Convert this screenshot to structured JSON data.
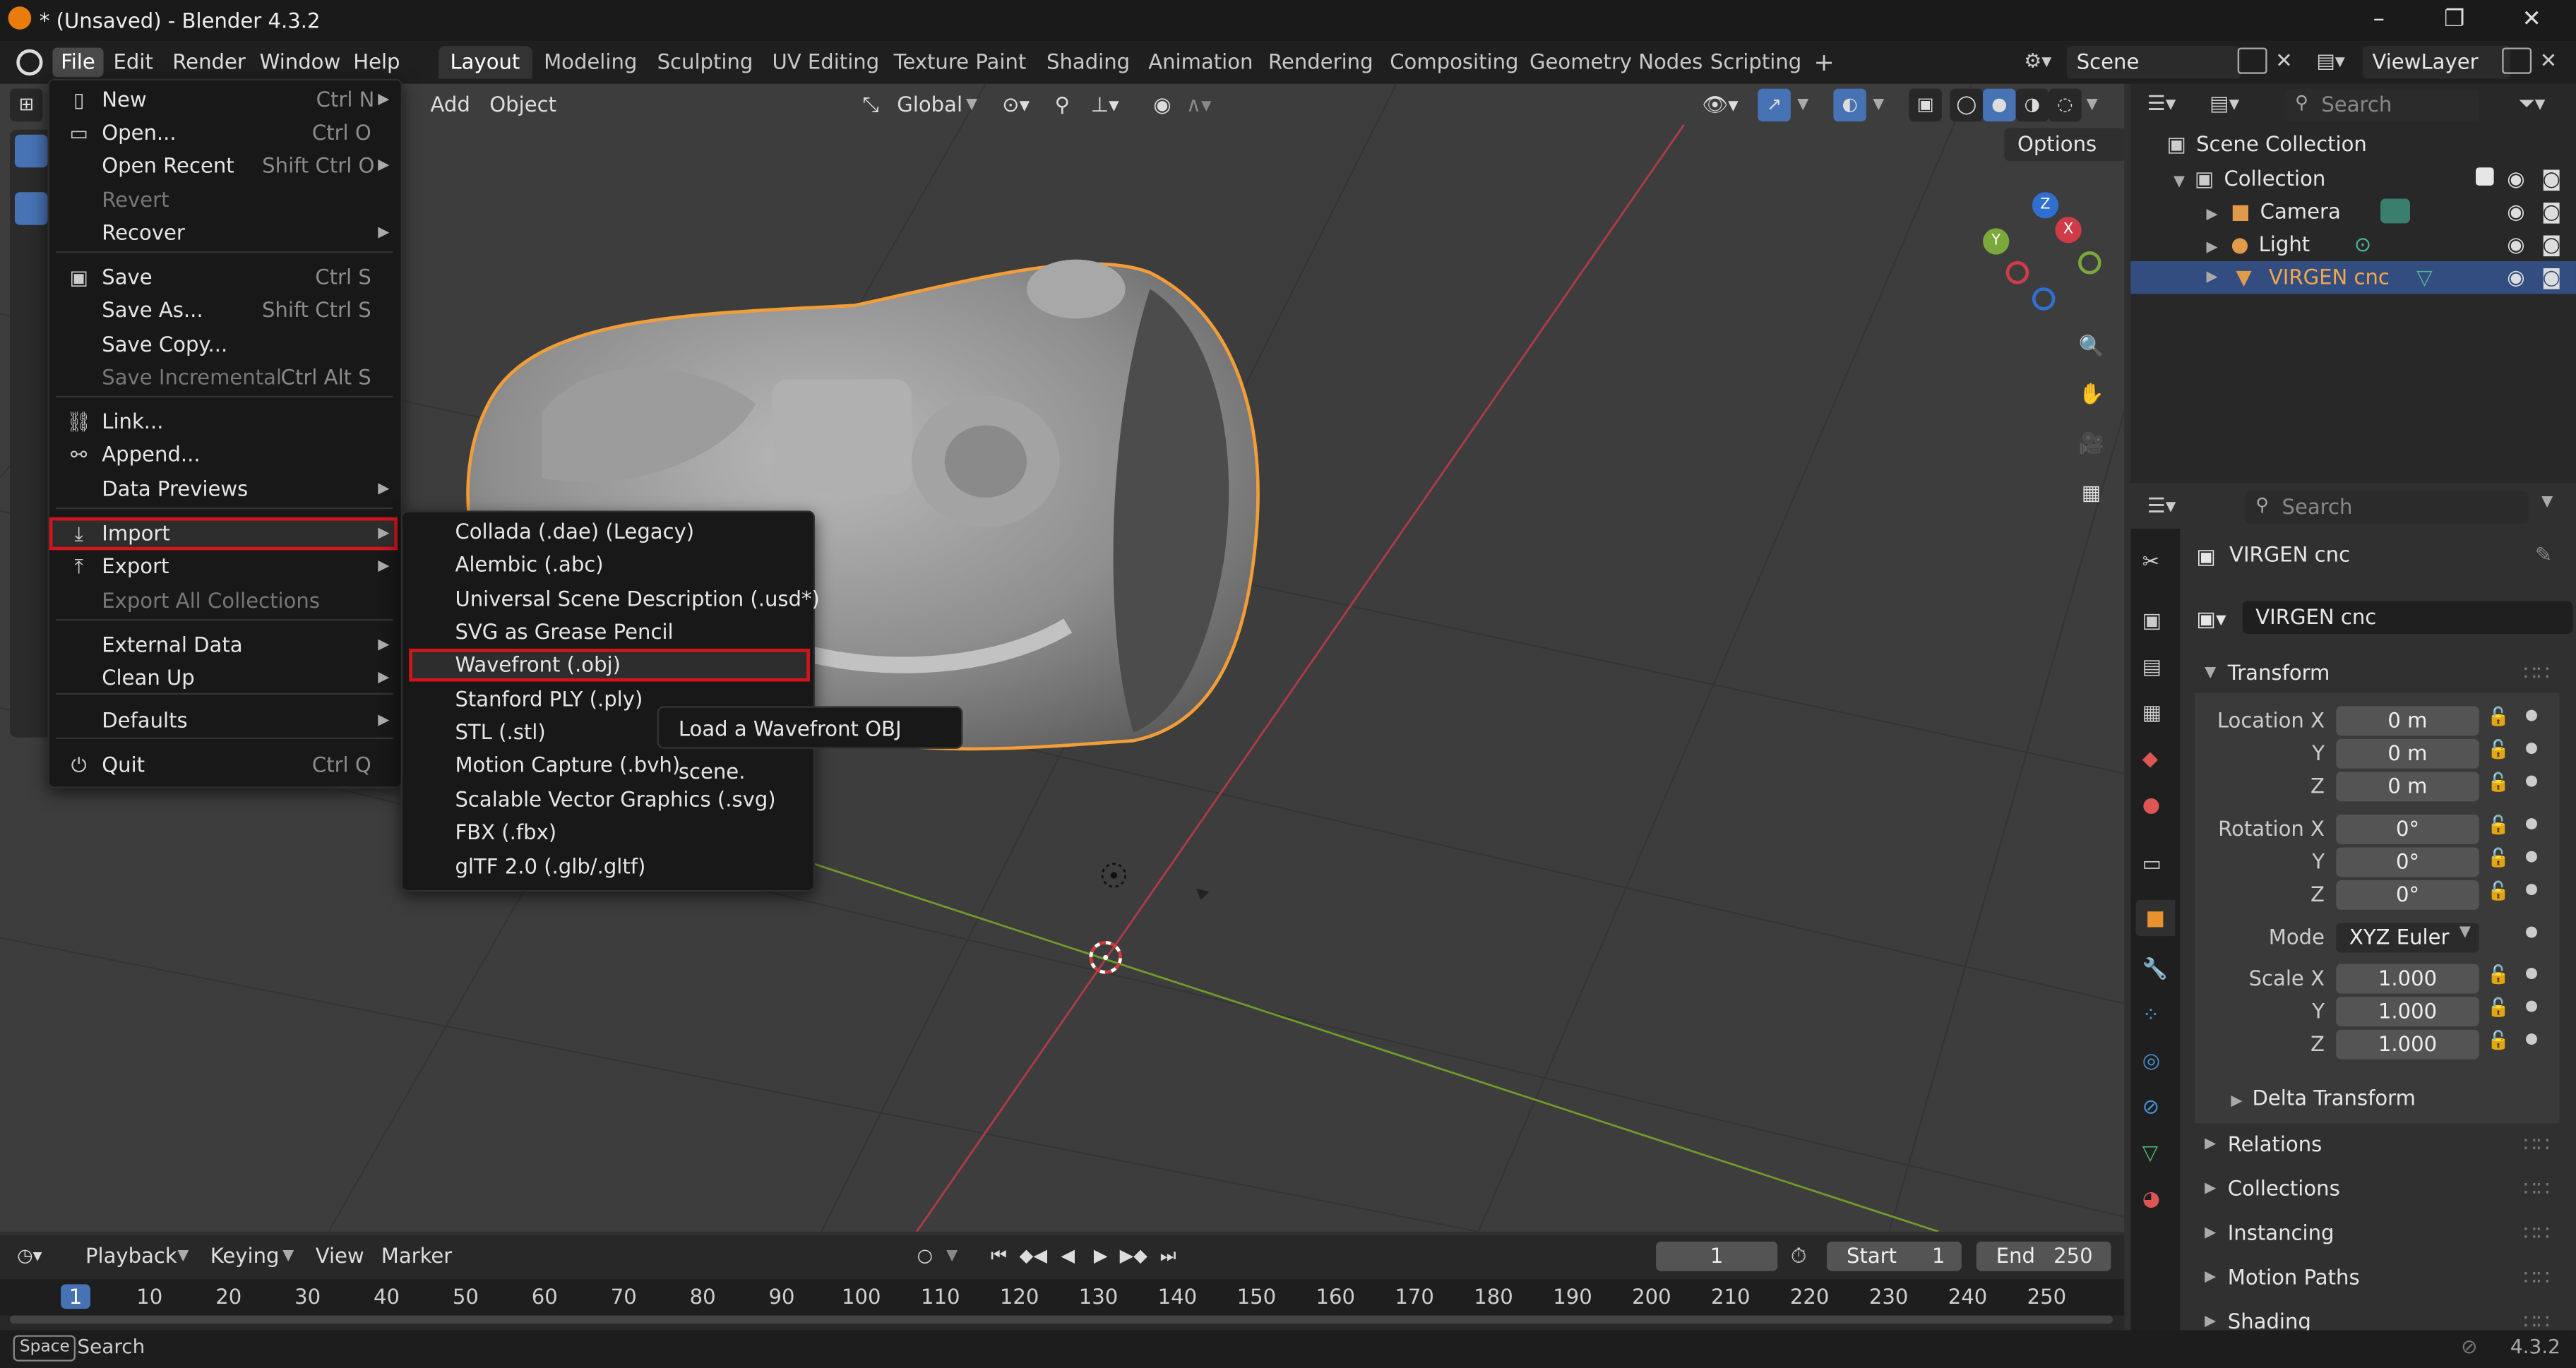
{
  "window": {
    "title": "* (Unsaved) - Blender 4.3.2",
    "minimize": "–",
    "maximize": "❐",
    "close": "✕"
  },
  "menubar": [
    "File",
    "Edit",
    "Render",
    "Window",
    "Help"
  ],
  "workspaces": [
    "Layout",
    "Modeling",
    "Sculpting",
    "UV Editing",
    "Texture Paint",
    "Shading",
    "Animation",
    "Rendering",
    "Compositing",
    "Geometry Nodes",
    "Scripting"
  ],
  "add_workspace": "+",
  "scene": {
    "name": "Scene",
    "view_layer": "ViewLayer"
  },
  "viewport": {
    "header_add": "Add",
    "header_object": "Object",
    "orientation": "Global",
    "options": "Options",
    "gizmo": {
      "z": "Z",
      "x": "X",
      "y": "Y"
    }
  },
  "file_menu": {
    "items": [
      {
        "label": "New",
        "shortcut": "Ctrl N",
        "icon": "new-file-icon",
        "submenu": true
      },
      {
        "label": "Open...",
        "shortcut": "Ctrl O",
        "icon": "folder-icon"
      },
      {
        "label": "Open Recent",
        "shortcut": "Shift Ctrl O",
        "submenu": true
      },
      {
        "label": "Revert",
        "disabled": true
      },
      {
        "label": "Recover",
        "submenu": true
      },
      {
        "label": "Save",
        "shortcut": "Ctrl S",
        "icon": "save-icon"
      },
      {
        "label": "Save As...",
        "shortcut": "Shift Ctrl S"
      },
      {
        "label": "Save Copy..."
      },
      {
        "label": "Save Incremental",
        "shortcut": "Ctrl Alt S",
        "disabled": true
      },
      {
        "label": "Link...",
        "icon": "link-icon"
      },
      {
        "label": "Append...",
        "icon": "append-icon"
      },
      {
        "label": "Data Previews",
        "submenu": true
      },
      {
        "label": "Import",
        "icon": "import-icon",
        "submenu": true,
        "highlighted": true
      },
      {
        "label": "Export",
        "icon": "export-icon",
        "submenu": true
      },
      {
        "label": "Export All Collections",
        "disabled": true
      },
      {
        "label": "External Data",
        "submenu": true
      },
      {
        "label": "Clean Up",
        "submenu": true
      },
      {
        "label": "Defaults",
        "submenu": true
      },
      {
        "label": "Quit",
        "shortcut": "Ctrl Q",
        "icon": "power-icon"
      }
    ]
  },
  "import_menu": {
    "items": [
      "Collada (.dae) (Legacy)",
      "Alembic (.abc)",
      "Universal Scene Description (.usd*)",
      "SVG as Grease Pencil",
      "Wavefront (.obj)",
      "Stanford PLY (.ply)",
      "STL (.stl)",
      "Motion Capture (.bvh)",
      "Scalable Vector Graphics (.svg)",
      "FBX (.fbx)",
      "glTF 2.0 (.glb/.gltf)"
    ],
    "highlighted_index": 4
  },
  "tooltip": "Load a Wavefront OBJ scene.",
  "outliner": {
    "search_placeholder": "Search",
    "scene_collection": "Scene Collection",
    "collection": "Collection",
    "items": [
      {
        "name": "Camera"
      },
      {
        "name": "Light"
      },
      {
        "name": "VIRGEN cnc",
        "selected": true
      }
    ]
  },
  "properties": {
    "search_placeholder": "Search",
    "object_name": "VIRGEN cnc",
    "data_name": "VIRGEN cnc",
    "transform": "Transform",
    "location": {
      "label": "Location X",
      "x": "0 m",
      "y": "0 m",
      "z": "0 m"
    },
    "rotation": {
      "label": "Rotation X",
      "x": "0°",
      "y": "0°",
      "z": "0°"
    },
    "mode_label": "Mode",
    "mode": "XYZ Euler",
    "scale": {
      "label": "Scale X",
      "x": "1.000",
      "y": "1.000",
      "z": "1.000"
    },
    "axis_y": "Y",
    "axis_z": "Z",
    "delta_transform": "Delta Transform",
    "sections": [
      "Relations",
      "Collections",
      "Instancing",
      "Motion Paths",
      "Shading"
    ]
  },
  "timeline": {
    "playback": "Playback",
    "keying": "Keying",
    "view": "View",
    "marker": "Marker",
    "current_frame": "1",
    "start_label": "Start",
    "start": "1",
    "end_label": "End",
    "end": "250",
    "ticks": [
      "1",
      "10",
      "20",
      "30",
      "40",
      "50",
      "60",
      "70",
      "80",
      "90",
      "100",
      "110",
      "120",
      "130",
      "140",
      "150",
      "160",
      "170",
      "180",
      "190",
      "200",
      "210",
      "220",
      "230",
      "240",
      "250"
    ]
  },
  "statusbar": {
    "key": "Space",
    "action": "Search",
    "version": "4.3.2"
  },
  "colors": {
    "accent": "#4772b3",
    "selection_orange": "#f29d38",
    "highlight_red": "#d2141c",
    "x_axis": "#b03a48",
    "y_axis": "#6f9b2a"
  }
}
